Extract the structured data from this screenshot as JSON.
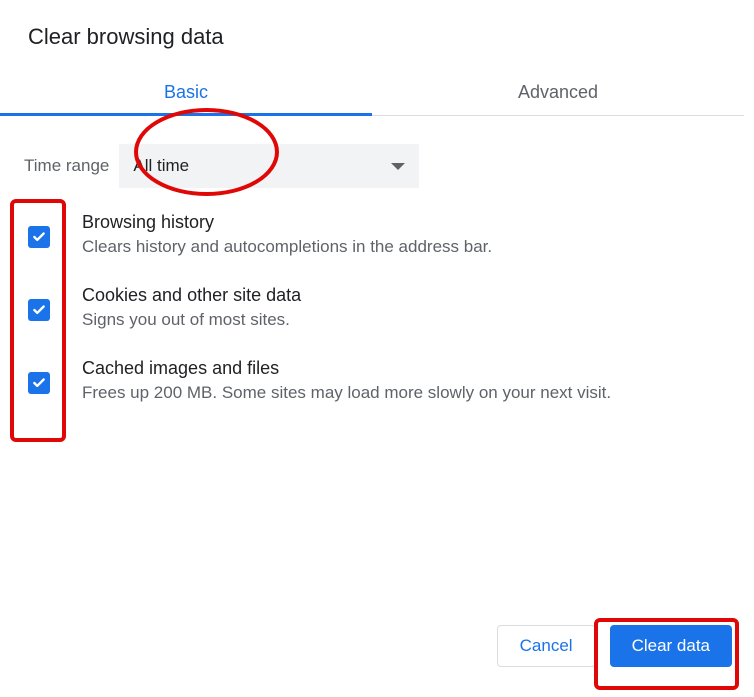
{
  "dialog": {
    "title": "Clear browsing data"
  },
  "tabs": {
    "basic": "Basic",
    "advanced": "Advanced"
  },
  "timeRange": {
    "label": "Time range",
    "value": "All time"
  },
  "options": [
    {
      "title": "Browsing history",
      "desc": "Clears history and autocompletions in the address bar."
    },
    {
      "title": "Cookies and other site data",
      "desc": "Signs you out of most sites."
    },
    {
      "title": "Cached images and files",
      "desc": "Frees up 200 MB. Some sites may load more slowly on your next visit."
    }
  ],
  "buttons": {
    "cancel": "Cancel",
    "clear": "Clear data"
  },
  "colors": {
    "accent": "#1a73e8",
    "annotation": "#e00707"
  }
}
